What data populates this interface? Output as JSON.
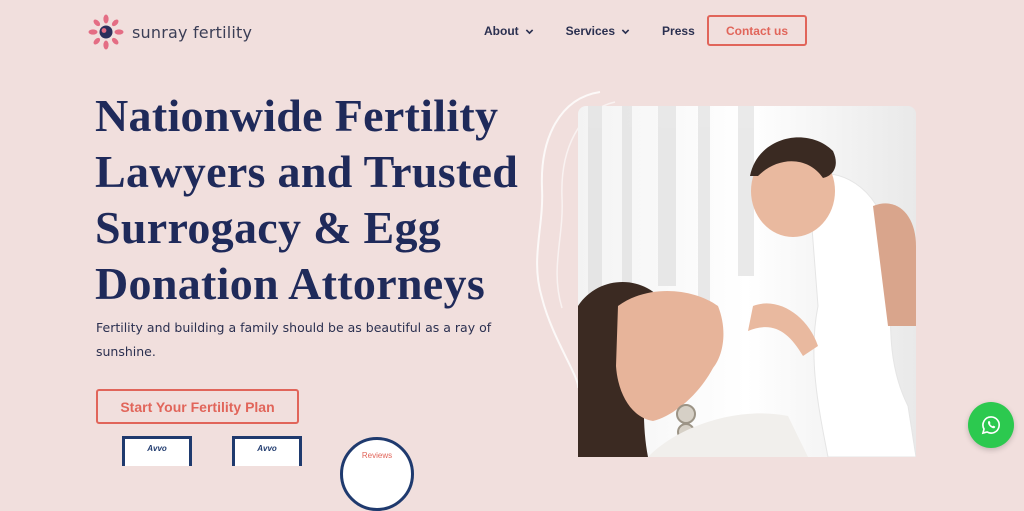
{
  "brand": {
    "name": "sunray fertility"
  },
  "nav": {
    "items": [
      {
        "label": "About",
        "has_dropdown": true
      },
      {
        "label": "Services",
        "has_dropdown": true
      },
      {
        "label": "Press",
        "has_dropdown": false
      }
    ],
    "contact_label": "Contact us"
  },
  "hero": {
    "headline_lines": [
      "Nationwide Fertility",
      "Lawyers and Trusted",
      "Surrogacy & Egg",
      "Donation Attorneys"
    ],
    "subtitle": "Fertility and building a family should be as beautiful as a ray of sunshine.",
    "cta_label": "Start Your Fertility Plan"
  },
  "badges": {
    "avvo_1": "Avvo",
    "avvo_2": "Avvo",
    "reviews": "Reviews"
  },
  "colors": {
    "background": "#f1dfdd",
    "navy": "#1f2a5a",
    "accent": "#e1655a",
    "whatsapp": "#2cc94f"
  },
  "icons": {
    "logo": "sunburst-logo-icon",
    "dropdown": "chevron-down-icon",
    "chat": "whatsapp-icon"
  }
}
